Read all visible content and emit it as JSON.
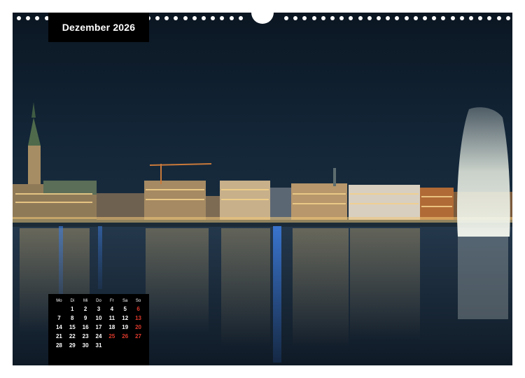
{
  "calendar": {
    "month_title": "Dezember 2026",
    "weekday_headers": [
      "Mo",
      "Di",
      "Mi",
      "Do",
      "Fr",
      "Sa",
      "So"
    ],
    "weeks": [
      [
        "",
        "1",
        "2",
        "3",
        "4",
        "5",
        "6"
      ],
      [
        "7",
        "8",
        "9",
        "10",
        "11",
        "12",
        "13"
      ],
      [
        "14",
        "15",
        "16",
        "17",
        "18",
        "19",
        "20"
      ],
      [
        "21",
        "22",
        "23",
        "24",
        "25",
        "26",
        "27"
      ],
      [
        "28",
        "29",
        "30",
        "31",
        "",
        "",
        ""
      ]
    ],
    "highlighted_days": [
      "6",
      "13",
      "20",
      "25",
      "26",
      "27"
    ],
    "accent_color": "#e03a2c"
  },
  "photo": {
    "subject": "night-skyline-over-lake-with-fountain",
    "sky_color": "#0d1b2a",
    "water_color": "#1d3246",
    "light_color": "#f2c879"
  }
}
